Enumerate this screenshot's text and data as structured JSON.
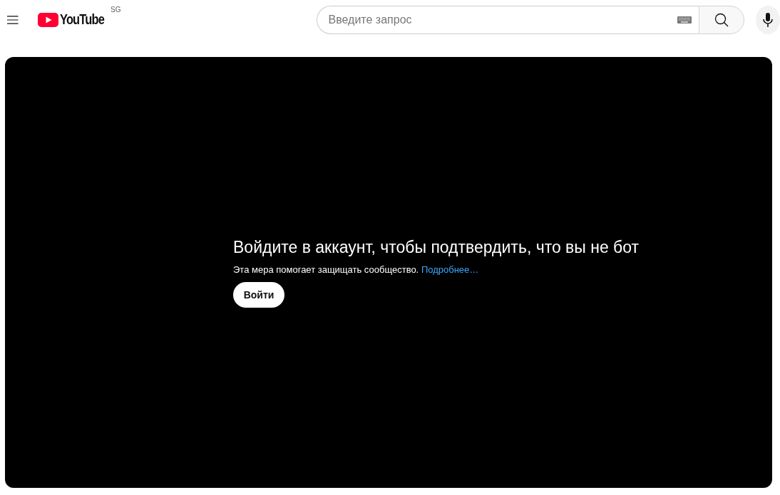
{
  "header": {
    "logo": "YouTube",
    "region": "SG",
    "search": {
      "placeholder": "Введите запрос"
    }
  },
  "player": {
    "title": "Войдите в аккаунт, чтобы подтвердить, что вы не бот",
    "message": "Эта мера помогает защищать сообщество.",
    "link": "Подробнее…",
    "button": "Войти"
  }
}
